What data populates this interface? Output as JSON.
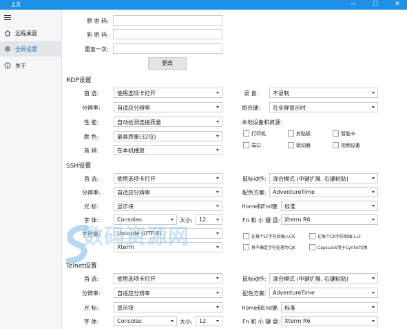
{
  "window": {
    "title": "主页",
    "controls": [
      "—",
      "☐",
      "✕"
    ]
  },
  "sidebar": {
    "items": [
      {
        "label": "远程桌面",
        "icon": "home-icon"
      },
      {
        "label": "全局设置",
        "icon": "gear-icon",
        "active": true
      },
      {
        "label": "关于",
        "icon": "info-icon"
      }
    ]
  },
  "password": {
    "old_label": "原 密 码:",
    "new_label": "新 密 码:",
    "repeat_label": "重复一次:",
    "change_button": "更改"
  },
  "rdp": {
    "title": "RDP设置",
    "rows": [
      {
        "label": "首 选:",
        "value": "使用选项卡打开"
      },
      {
        "label": "分辨率:",
        "value": "自适应分辨率"
      },
      {
        "label": "性 能:",
        "value": "自动检测连接质量"
      },
      {
        "label": "颜 色:",
        "value": "最高质量(32位)"
      },
      {
        "label": "音 频:",
        "value": "在本机播放"
      }
    ],
    "record_label": "录 音:",
    "record_value": "不录制",
    "combo_label": "组合键:",
    "combo_value": "在全屏显示时",
    "local_label": "本地设备和资源:",
    "devices": [
      "打印机",
      "剪贴板",
      "智能卡",
      "端口",
      "驱动器",
      "视频设备"
    ]
  },
  "ssh": {
    "title": "SSH设置",
    "rows": [
      {
        "label": "首 选:",
        "value": "使用选项卡打开"
      },
      {
        "label": "分辨率:",
        "value": "自适应分辨率"
      },
      {
        "label": "光 标:",
        "value": "显示块"
      },
      {
        "label": "字 体:",
        "value": "Consolas"
      },
      {
        "label": "字符集:",
        "value": "Unicode (UTF-8)"
      },
      {
        "label": "",
        "value": "Xterm"
      }
    ],
    "size_label": "大小:",
    "size_value": "12",
    "right_rows": [
      {
        "label": "鼠标动作:",
        "value": "混合模式 (中键扩展, 右键粘贴)"
      },
      {
        "label": "配色方案:",
        "value": "AdventureTime"
      },
      {
        "label": "Home和End键:",
        "value": "标准"
      },
      {
        "label": "Fn 和 小 键 盘:",
        "value": "Xterm R6"
      }
    ],
    "checks": [
      "在每个LF字符后插入CR",
      "在每个CR字符后插入LF",
      "将不确定字符处理为CJK",
      "CapsLock用于Cyrillic切换"
    ]
  },
  "telnet": {
    "title": "Telnet设置",
    "rows": [
      {
        "label": "首 选:",
        "value": "使用选项卡打开"
      },
      {
        "label": "分辨率:",
        "value": "自适应分辨率"
      },
      {
        "label": "光 标:",
        "value": "显示块"
      },
      {
        "label": "字 体:",
        "value": "Consolas"
      }
    ],
    "size_label": "大小:",
    "size_value": "12",
    "right_rows": [
      {
        "label": "鼠标动作:",
        "value": "混合模式 (中键扩展, 右键粘贴)"
      },
      {
        "label": "配色方案:",
        "value": "AdventureTime"
      },
      {
        "label": "Home和End键:",
        "value": "标准"
      },
      {
        "label": "Fn 和 小 键 盘:",
        "value": "Xterm R6"
      }
    ]
  },
  "watermark": "数码资源网"
}
